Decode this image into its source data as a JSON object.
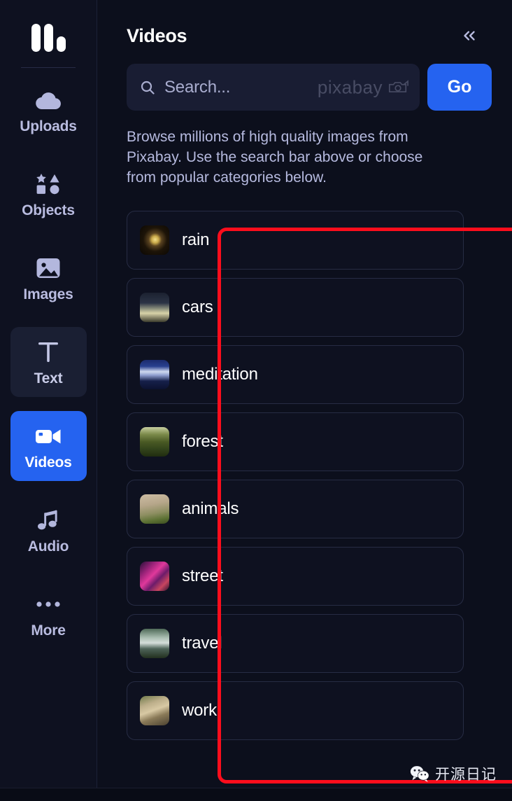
{
  "app": {
    "logo_name": "bars-logo",
    "accent_color": "#2563f0",
    "background_color": "#0c0f1c",
    "sidebar_color": "#0e1120",
    "highlight_color": "#fc0d1c"
  },
  "sidebar": {
    "items": [
      {
        "label": "Uploads",
        "icon": "cloud-upload-icon",
        "state": "default"
      },
      {
        "label": "Objects",
        "icon": "shapes-icon",
        "state": "default"
      },
      {
        "label": "Images",
        "icon": "image-icon",
        "state": "default"
      },
      {
        "label": "Text",
        "icon": "text-t-icon",
        "state": "hovered"
      },
      {
        "label": "Videos",
        "icon": "video-camera-icon",
        "state": "active"
      },
      {
        "label": "Audio",
        "icon": "music-note-icon",
        "state": "default"
      },
      {
        "label": "More",
        "icon": "ellipsis-icon",
        "state": "default"
      }
    ]
  },
  "panel": {
    "title": "Videos",
    "collapse_label": "«",
    "search": {
      "placeholder": "Search...",
      "value": "",
      "icon": "search-icon",
      "provider_mark": "pixabay",
      "provider_icon": "camera-icon"
    },
    "go_button": "Go",
    "description": "Browse millions of high quality images from Pixabay. Use the search bar above or choose from popular categories below.",
    "categories": [
      {
        "label": "rain",
        "thumb": "th-rain"
      },
      {
        "label": "cars",
        "thumb": "th-cars"
      },
      {
        "label": "meditation",
        "thumb": "th-meditation"
      },
      {
        "label": "forest",
        "thumb": "th-forest"
      },
      {
        "label": "animals",
        "thumb": "th-animals"
      },
      {
        "label": "street",
        "thumb": "th-street"
      },
      {
        "label": "travel",
        "thumb": "th-travel"
      },
      {
        "label": "work",
        "thumb": "th-work"
      }
    ]
  },
  "watermark": {
    "text": "开源日记",
    "icon": "wechat-icon"
  }
}
